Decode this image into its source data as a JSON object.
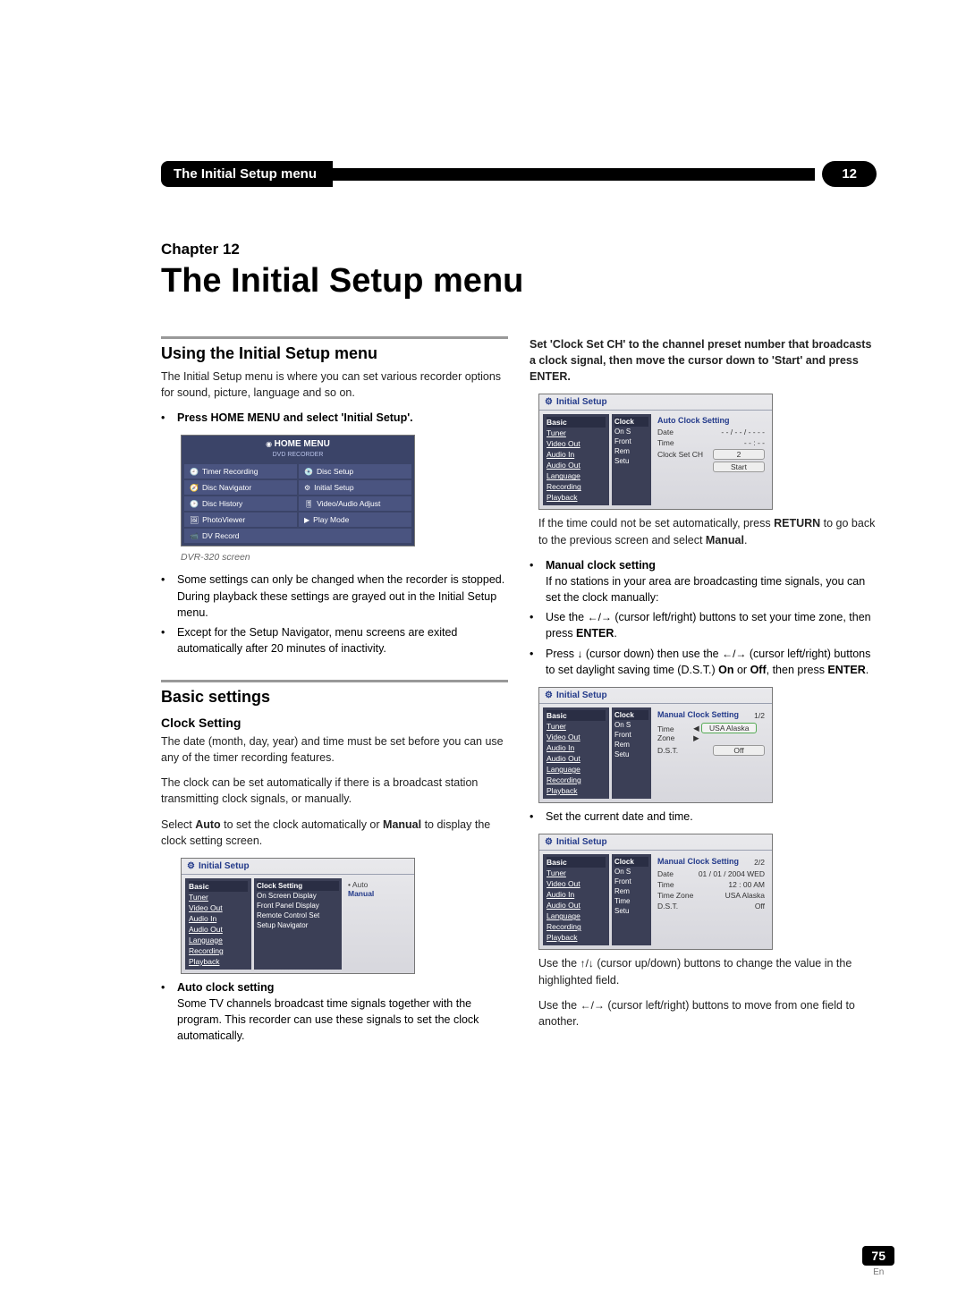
{
  "header": {
    "title_tab": "The Initial Setup menu",
    "chapter_num": "12"
  },
  "chapter_label": "Chapter 12",
  "title": "The Initial Setup menu",
  "left": {
    "sec1_heading": "Using the Initial Setup menu",
    "sec1_p1": "The Initial Setup menu is where you can set various recorder options for sound, picture, language and so on.",
    "sec1_b1_label": "Press HOME MENU and select 'Initial Setup'.",
    "homemenu": {
      "brand": "HOME MENU",
      "sub": "DVD RECORDER",
      "items": [
        [
          "Timer Recording",
          "Disc Setup"
        ],
        [
          "Disc Navigator",
          "Initial Setup"
        ],
        [
          "Disc History",
          "Video/Audio Adjust"
        ],
        [
          "PhotoViewer",
          "Play Mode"
        ],
        [
          "DV Record",
          ""
        ]
      ]
    },
    "fig_caption": "DVR-320 screen",
    "notes": [
      "Some settings can only be changed when the recorder is stopped. During playback these settings are grayed out in the Initial Setup menu.",
      "Except for the Setup Navigator, menu screens are exited automatically after 20 minutes of inactivity."
    ],
    "sec2_heading": "Basic settings",
    "sub_clock": "Clock Setting",
    "clock_p1": "The date (month, day, year) and time must be set before you can use any of the timer recording features.",
    "clock_p2": "The clock can be set automatically if there is a broadcast station transmitting clock signals, or manually.",
    "clock_p3a": "Select ",
    "clock_p3b": "Auto",
    "clock_p3c": " to set the clock automatically or ",
    "clock_p3d": "Manual",
    "clock_p3e": " to display the clock setting screen.",
    "ui_clockset": {
      "title": "Initial Setup",
      "sidebar": [
        "Basic",
        "Tuner",
        "Video Out",
        "Audio In",
        "Audio Out",
        "Language",
        "Recording",
        "Playback"
      ],
      "mid": [
        "Clock Setting",
        "On Screen Display",
        "Front Panel Display",
        "Remote Control Set",
        "Setup Navigator"
      ],
      "right_auto": "Auto",
      "right_manual": "Manual"
    },
    "auto_head": "Auto clock setting",
    "auto_p": "Some TV channels broadcast time signals together with the program. This recorder can use these signals to set the clock automatically."
  },
  "right": {
    "top_bold": "Set 'Clock Set CH' to the channel preset number that broadcasts a clock signal, then move the cursor down to 'Start' and press ENTER.",
    "ui_auto": {
      "title": "Initial Setup",
      "sidebar": [
        "Basic",
        "Tuner",
        "Video Out",
        "Audio In",
        "Audio Out",
        "Language",
        "Recording",
        "Playback"
      ],
      "mid": [
        "Clock",
        "On S",
        "Front",
        "Rem",
        "Setu"
      ],
      "panel_title": "Auto Clock Setting",
      "rows": {
        "Date": "- - / - - / - - - -",
        "Time": "- - : - -",
        "Clock Set CH": "2"
      },
      "start": "Start"
    },
    "p_return_a": "If the time could not be set automatically, press ",
    "p_return_b": "RETURN",
    "p_return_c": " to go back to the previous screen and select ",
    "p_return_d": "Manual",
    "p_return_e": ".",
    "manual_head": "Manual clock setting",
    "manual_intro": "If no stations in your area are broadcasting time signals, you can set the clock manually:",
    "manual_steps": [
      {
        "pre": "Use the ",
        "arrows": "←/→",
        "mid": " (cursor left/right) buttons to set your time zone, then press ",
        "bold": "ENTER",
        "post": "."
      },
      {
        "pre": "Press ",
        "arrows": "↓",
        "mid": " (cursor down) then use the ",
        "arrows2": "←/→",
        "mid2": " (cursor left/right) buttons to set daylight saving time (D.S.T.) ",
        "bold": "On",
        "mid3": " or ",
        "bold2": "Off",
        "mid4": ", then press ",
        "bold3": "ENTER",
        "post": "."
      }
    ],
    "ui_manual1": {
      "title": "Initial Setup",
      "panel_title": "Manual Clock Setting",
      "page": "1/2",
      "tz_label": "Time Zone",
      "tz_val": "USA Alaska",
      "dst_label": "D.S.T.",
      "dst_val": "Off"
    },
    "set_current": "Set the current date and time.",
    "ui_manual2": {
      "title": "Initial Setup",
      "panel_title": "Manual Clock Setting",
      "page": "2/2",
      "date_label": "Date",
      "date_val": "01 / 01 / 2004  WED",
      "time_label": "Time",
      "time_val": "12 : 00  AM",
      "tz_label": "Time Zone",
      "tz_val": "USA Alaska",
      "dst_label": "D.S.T.",
      "dst_val": "Off"
    },
    "tail1_a": "Use the ",
    "tail1_b": "↑/↓",
    "tail1_c": " (cursor up/down) buttons to change the value in the highlighted field.",
    "tail2_a": "Use the ",
    "tail2_b": "←/→",
    "tail2_c": " (cursor left/right) buttons to move from one field to another."
  },
  "page_num": "75",
  "page_lang": "En"
}
